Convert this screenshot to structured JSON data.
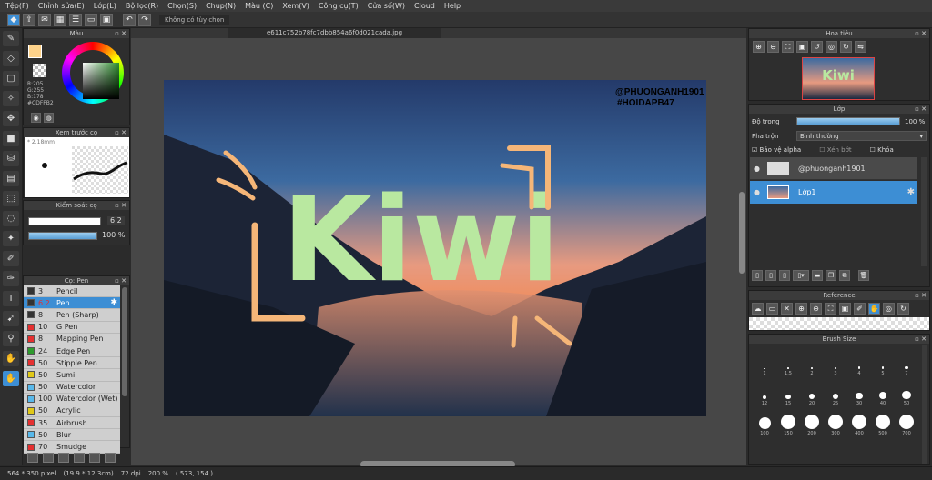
{
  "menu": [
    "Tệp(F)",
    "Chỉnh sửa(E)",
    "Lớp(L)",
    "Bộ lọc(R)",
    "Chọn(S)",
    "Chụp(N)",
    "Màu (C)",
    "Xem(V)",
    "Công cụ(T)",
    "Cửa số(W)",
    "Cloud",
    "Help"
  ],
  "toolbar": {
    "options_label": "Không có tùy chọn"
  },
  "color_panel": {
    "title": "Màu",
    "rgb_text": "R:205\nG:255\nB:178\n#CDFFB2",
    "fg_color": "#FDD28A"
  },
  "preview": {
    "title": "Xem trước cọ",
    "size": "2.18mm"
  },
  "brush_control": {
    "title": "Kiểm soát cọ",
    "size": "6.2",
    "opacity": "100 %"
  },
  "pen_panel": {
    "title": "Cọ: Pen",
    "items": [
      {
        "size": "3",
        "name": "Pencil",
        "color": "#333333"
      },
      {
        "size": "6.2",
        "name": "Pen",
        "color": "#333333"
      },
      {
        "size": "8",
        "name": "Pen (Sharp)",
        "color": "#333333"
      },
      {
        "size": "10",
        "name": "G Pen",
        "color": "#e53030"
      },
      {
        "size": "8",
        "name": "Mapping Pen",
        "color": "#e53030"
      },
      {
        "size": "24",
        "name": "Edge Pen",
        "color": "#2e9c2e"
      },
      {
        "size": "50",
        "name": "Stipple Pen",
        "color": "#e53030"
      },
      {
        "size": "50",
        "name": "Sumi",
        "color": "#e0c818"
      },
      {
        "size": "50",
        "name": "Watercolor",
        "color": "#58b8ea"
      },
      {
        "size": "100",
        "name": "Watercolor (Wet)",
        "color": "#58b8ea"
      },
      {
        "size": "50",
        "name": "Acrylic",
        "color": "#e0c818"
      },
      {
        "size": "35",
        "name": "Airbrush",
        "color": "#e53030"
      },
      {
        "size": "50",
        "name": "Blur",
        "color": "#58b8ea"
      },
      {
        "size": "70",
        "name": "Smudge",
        "color": "#e53030"
      }
    ]
  },
  "canvas": {
    "tab": "e611c752b78fc7dbb854a6f0d021cada.jpg",
    "watermark_1": "@PHUONGANH1901",
    "watermark_2": "#HOIDAPB47",
    "art_title": "Kiwi"
  },
  "navigator": {
    "title": "Hoa tiêu"
  },
  "layers": {
    "title": "Lớp",
    "opacity_label": "Độ trong",
    "opacity_value": "100 %",
    "blend_label": "Pha trộn",
    "blend_value": "Bình thường",
    "protect_alpha": "Bảo vệ alpha",
    "clipping": "Xén bớt",
    "lock": "Khóa",
    "items": [
      "@phuonganh1901",
      "Lớp1"
    ]
  },
  "reference": {
    "title": "Reference"
  },
  "brush_size": {
    "title": "Brush Size",
    "sizes": [
      "1",
      "1.5",
      "2",
      "3",
      "4",
      "5",
      "7",
      "12",
      "15",
      "20",
      "25",
      "30",
      "40",
      "50",
      "100",
      "150",
      "200",
      "300",
      "400",
      "500",
      "700"
    ]
  },
  "status": {
    "pixels": "564 * 350 pixel",
    "physical": "(19.9 * 12.3cm)",
    "dpi": "72 dpi",
    "zoom": "200 %",
    "coords": "( 573, 154 )"
  }
}
